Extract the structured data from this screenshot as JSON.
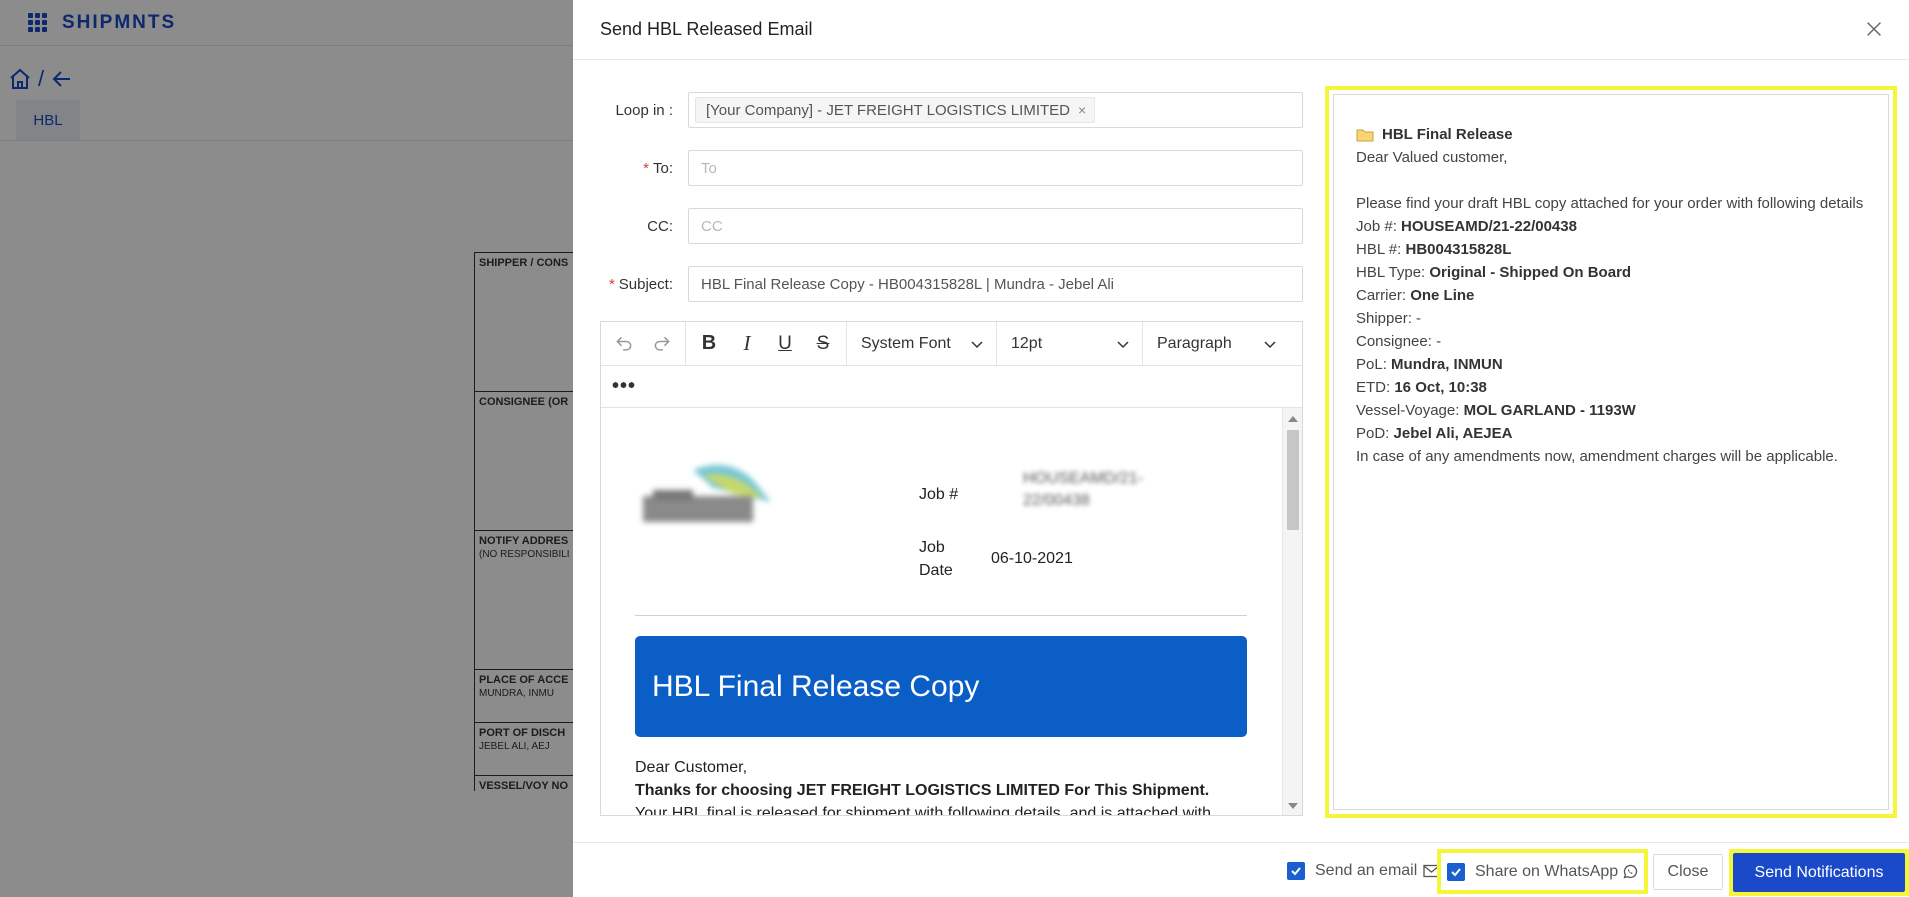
{
  "app": {
    "brand": "SHIPMNTS",
    "crumb_sep": "/",
    "tab": "HBL"
  },
  "background_doc": {
    "boxes": [
      "SHIPPER / CONS",
      "CONSIGNEE (OR",
      "NOTIFY ADDRES",
      "PLACE OF ACCE",
      "PORT OF DISCH",
      "VESSEL/VOY NO"
    ],
    "notify_sub": "(NO RESPONSIBILI",
    "place_sub": "MUNDRA, INMU",
    "port_sub": "JEBEL ALI, AEJ"
  },
  "modal": {
    "title": "Send HBL Released Email",
    "loop_in": {
      "label": "Loop in",
      "tag": "[Your Company] - JET FREIGHT LOGISTICS LIMITED"
    },
    "to": {
      "label": "To",
      "placeholder": "To",
      "value": ""
    },
    "cc": {
      "label": "CC",
      "placeholder": "CC",
      "value": ""
    },
    "subject": {
      "label": "Subject",
      "value": "HBL Final Release Copy - HB004315828L | Mundra - Jebel Ali"
    },
    "colon": ":",
    "required_mark": "*",
    "toolbar": {
      "font": "System Font",
      "size": "12pt",
      "block": "Paragraph",
      "more": "•••"
    },
    "email": {
      "job_label": "Job #",
      "job_value": "HOUSEAMD/21-22/00438",
      "job_date_label_1": "Job",
      "job_date_label_2": "Date",
      "job_date": "06-10-2021",
      "banner": "HBL Final Release Copy",
      "greeting": "Dear Customer,",
      "thanks": "Thanks for choosing JET FREIGHT LOGISTICS LIMITED For This Shipment.",
      "line3": "Your HBL final is released for shipment with following details, and is attached with"
    },
    "preview": {
      "title": "HBL Final Release",
      "greeting": "Dear Valued customer,",
      "intro": "Please find your draft HBL copy attached for your order with following details",
      "fields": [
        {
          "label": "Job #:",
          "value": "HOUSEAMD/21-22/00438"
        },
        {
          "label": "HBL #:",
          "value": "HB004315828L"
        },
        {
          "label": "HBL Type:",
          "value": "Original - Shipped On Board"
        },
        {
          "label": "Carrier:",
          "value": "One Line"
        },
        {
          "label": "Shipper:",
          "value": "-"
        },
        {
          "label": "Consignee:",
          "value": "-"
        },
        {
          "label": "PoL:",
          "value": "Mundra, INMUN"
        },
        {
          "label": "ETD:",
          "value": "16 Oct, 10:38"
        },
        {
          "label": "Vessel-Voyage:",
          "value": "MOL GARLAND - 1193W"
        },
        {
          "label": "PoD:",
          "value": "Jebel Ali, AEJEA"
        }
      ],
      "footer": "In case of any amendments now, amendment charges will be applicable."
    },
    "footer": {
      "send_email": "Send an email",
      "share_whatsapp": "Share on WhatsApp",
      "close": "Close",
      "send": "Send Notifications"
    }
  },
  "colors": {
    "primary": "#1a49c9",
    "banner": "#0c5ec7",
    "highlight": "#f5f53a"
  }
}
